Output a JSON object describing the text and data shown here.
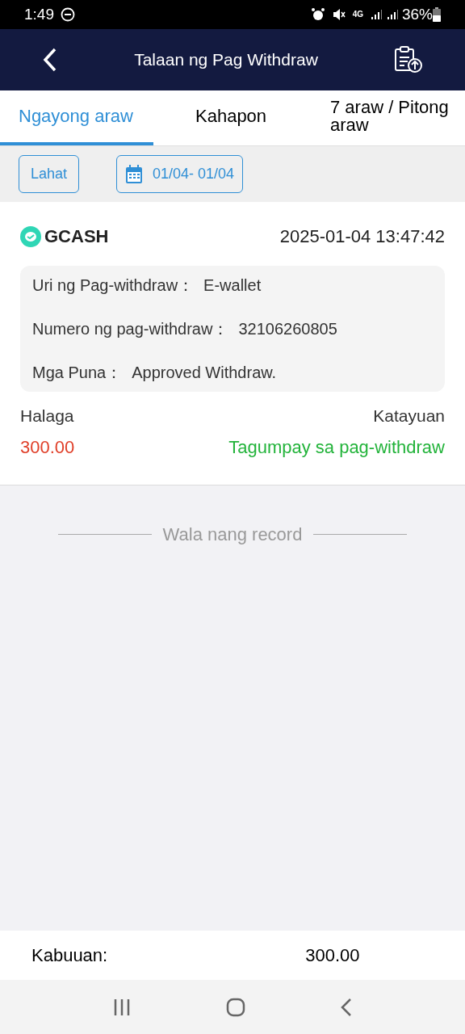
{
  "status_bar": {
    "time": "1:49",
    "network": "4G",
    "battery": "36%"
  },
  "header": {
    "title": "Talaan ng Pag Withdraw"
  },
  "tabs": [
    {
      "label": "Ngayong araw",
      "selected": true
    },
    {
      "label": "Kahapon",
      "selected": false
    },
    {
      "label": "7 araw / Pitong araw",
      "selected": false
    }
  ],
  "filters": {
    "all": "Lahat",
    "date_range": "01/04- 01/04"
  },
  "records": [
    {
      "method": "GCASH",
      "datetime": "2025-01-04 13:47:42",
      "details": [
        {
          "label": "Uri ng Pag-withdraw：",
          "value": "E-wallet"
        },
        {
          "label": "Numero ng pag-withdraw：",
          "value": "32106260805"
        },
        {
          "label": "Mga Puna：",
          "value": "Approved Withdraw."
        }
      ],
      "amount_label": "Halaga",
      "amount": "300.00",
      "status_label": "Katayuan",
      "status": "Tagumpay sa pag-withdraw",
      "success": true
    }
  ],
  "end_message": "Wala nang record",
  "total": {
    "label": "Kabuuan:",
    "value": "300.00"
  }
}
